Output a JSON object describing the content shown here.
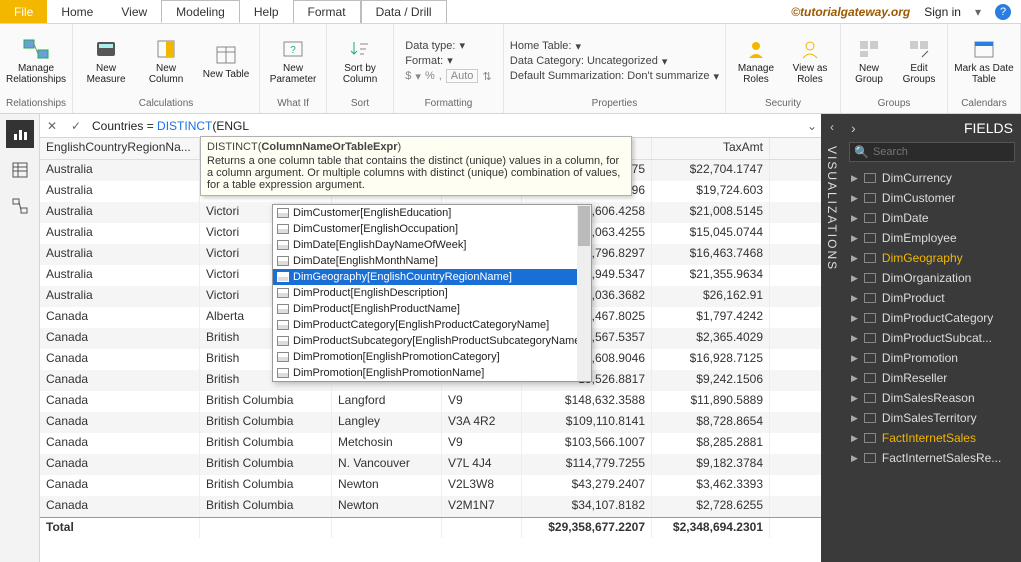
{
  "menu": {
    "file": "File",
    "tabs": [
      "Home",
      "View",
      "Modeling",
      "Help",
      "Format",
      "Data / Drill"
    ],
    "active_index": 2,
    "watermark": "©tutorialgateway.org",
    "signin": "Sign in"
  },
  "ribbon": {
    "relationships": {
      "label": "Relationships",
      "manage": "Manage Relationships"
    },
    "calculations": {
      "label": "Calculations",
      "measure": "New Measure",
      "column": "New Column",
      "table": "New Table"
    },
    "whatif": {
      "label": "What If",
      "param": "New Parameter"
    },
    "sort": {
      "label": "Sort",
      "btn": "Sort by Column"
    },
    "formatting": {
      "label": "Formatting",
      "datatype": "Data type:",
      "format": "Format:",
      "auto": "Auto",
      "currency": "$",
      "percent": "%",
      "comma": ","
    },
    "properties": {
      "label": "Properties",
      "home_table": "Home Table:",
      "data_category": "Data Category: Uncategorized",
      "summarization": "Default Summarization: Don't summarize"
    },
    "security": {
      "label": "Security",
      "manage": "Manage Roles",
      "view": "View as Roles"
    },
    "groups": {
      "label": "Groups",
      "new": "New Group",
      "edit": "Edit Groups"
    },
    "calendars": {
      "label": "Calendars",
      "mark": "Mark as Date Table"
    }
  },
  "formula": {
    "prefix": "Countries = ",
    "fn": "DISTINCT",
    "arg": "(ENGL"
  },
  "tooltip": {
    "signature_fn": "DISTINCT",
    "signature_arg": "ColumnNameOrTableExpr",
    "desc": "Returns a one column table that contains the distinct (unique) values in a column, for a column argument. Or multiple columns with distinct (unique) combination of values, for a table expression argument."
  },
  "intellisense": {
    "items": [
      "DimCustomer[EnglishEducation]",
      "DimCustomer[EnglishOccupation]",
      "DimDate[EnglishDayNameOfWeek]",
      "DimDate[EnglishMonthName]",
      "DimGeography[EnglishCountryRegionName]",
      "DimProduct[EnglishDescription]",
      "DimProduct[EnglishProductName]",
      "DimProductCategory[EnglishProductCategoryName]",
      "DimProductSubcategory[EnglishProductSubcategoryName]",
      "DimPromotion[EnglishPromotionCategory]",
      "DimPromotion[EnglishPromotionName]"
    ],
    "selected_index": 4
  },
  "table": {
    "headers": [
      "EnglishCountryRegionNa...",
      "",
      "",
      "",
      "",
      "TaxAmt"
    ],
    "rows": [
      [
        "Australia",
        "",
        "",
        "",
        "175",
        "$22,704.1747"
      ],
      [
        "Australia",
        "",
        "",
        "",
        "6296",
        "$19,724.603"
      ],
      [
        "Australia",
        "Victori",
        "",
        "",
        "262,606.4258",
        "$21,008.5145"
      ],
      [
        "Australia",
        "Victori",
        "",
        "",
        "88,063.4255",
        "$15,045.0744"
      ],
      [
        "Australia",
        "Victori",
        "",
        "",
        "205,796.8297",
        "$16,463.7468"
      ],
      [
        "Australia",
        "Victori",
        "",
        "",
        "266,949.5347",
        "$21,355.9634"
      ],
      [
        "Australia",
        "Victori",
        "",
        "",
        "27,036.3682",
        "$26,162.91"
      ],
      [
        "Canada",
        "Alberta",
        "",
        "",
        "22,467.8025",
        "$1,797.4242"
      ],
      [
        "Canada",
        "British",
        "",
        "",
        "329,567.5357",
        "$2,365.4029"
      ],
      [
        "Canada",
        "British",
        "",
        "",
        "211,608.9046",
        "$16,928.7125"
      ],
      [
        "Canada",
        "British",
        "",
        "",
        "15,526.8817",
        "$9,242.1506"
      ],
      [
        "Canada",
        "British Columbia",
        "Langford",
        "V9",
        "$148,632.3588",
        "$11,890.5889"
      ],
      [
        "Canada",
        "British Columbia",
        "Langley",
        "V3A 4R2",
        "$109,110.8141",
        "$8,728.8654"
      ],
      [
        "Canada",
        "British Columbia",
        "Metchosin",
        "V9",
        "$103,566.1007",
        "$8,285.2881"
      ],
      [
        "Canada",
        "British Columbia",
        "N. Vancouver",
        "V7L 4J4",
        "$114,779.7255",
        "$9,182.3784"
      ],
      [
        "Canada",
        "British Columbia",
        "Newton",
        "V2L3W8",
        "$43,279.2407",
        "$3,462.3393"
      ],
      [
        "Canada",
        "British Columbia",
        "Newton",
        "V2M1N7",
        "$34,107.8182",
        "$2,728.6255"
      ]
    ],
    "total_label": "Total",
    "total_values": [
      "$29,358,677.2207",
      "$2,348,694.2301"
    ]
  },
  "viz": {
    "label": "VISUALIZATIONS",
    "chev": "‹"
  },
  "fields": {
    "label": "FIELDS",
    "chev": "›",
    "search_placeholder": "Search",
    "items": [
      {
        "name": "DimCurrency",
        "sel": false
      },
      {
        "name": "DimCustomer",
        "sel": false
      },
      {
        "name": "DimDate",
        "sel": false
      },
      {
        "name": "DimEmployee",
        "sel": false
      },
      {
        "name": "DimGeography",
        "sel": true
      },
      {
        "name": "DimOrganization",
        "sel": false
      },
      {
        "name": "DimProduct",
        "sel": false
      },
      {
        "name": "DimProductCategory",
        "sel": false
      },
      {
        "name": "DimProductSubcat...",
        "sel": false
      },
      {
        "name": "DimPromotion",
        "sel": false
      },
      {
        "name": "DimReseller",
        "sel": false
      },
      {
        "name": "DimSalesReason",
        "sel": false
      },
      {
        "name": "DimSalesTerritory",
        "sel": false
      },
      {
        "name": "FactInternetSales",
        "sel": true
      },
      {
        "name": "FactInternetSalesRe...",
        "sel": false
      }
    ]
  }
}
